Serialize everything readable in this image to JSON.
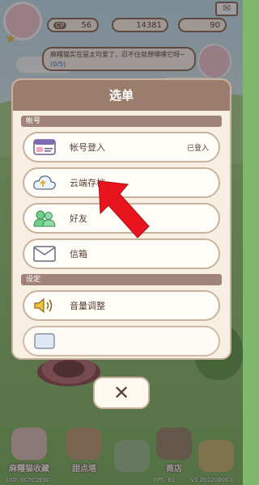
{
  "hud": {
    "cp_label": "CP",
    "cp_value": "56",
    "coins": "14381",
    "gems": "90"
  },
  "speech": {
    "text": "麻糬猫实在是太可爱了，忍不住就想嘿嘿它呀~",
    "progress": "(0/5)"
  },
  "menu": {
    "title": "选单",
    "section_account": "帐号",
    "section_settings": "设定",
    "items": [
      {
        "label": "帐号登入",
        "state": "已登入",
        "icon": "id-card-icon"
      },
      {
        "label": "云端存档",
        "state": "",
        "icon": "cloud-save-icon"
      },
      {
        "label": "好友",
        "state": "",
        "icon": "friends-icon"
      },
      {
        "label": "信箱",
        "state": "",
        "icon": "mail-icon"
      }
    ],
    "settings_items": [
      {
        "label": "音量调整",
        "icon": "speaker-icon"
      }
    ]
  },
  "close_label": "✕",
  "bottom_nav": [
    {
      "label": "麻糬猫收藏"
    },
    {
      "label": "甜点塔"
    },
    {
      "label": ""
    },
    {
      "label": "商店"
    },
    {
      "label": ""
    }
  ],
  "footer": {
    "uid": "UID: 0C7C2E9D",
    "fps": "FPS: 61",
    "version": "v1.20220806.0"
  },
  "colors": {
    "panel": "#f8efe3",
    "header": "#9b7d6e",
    "arrow": "#e8141e"
  }
}
